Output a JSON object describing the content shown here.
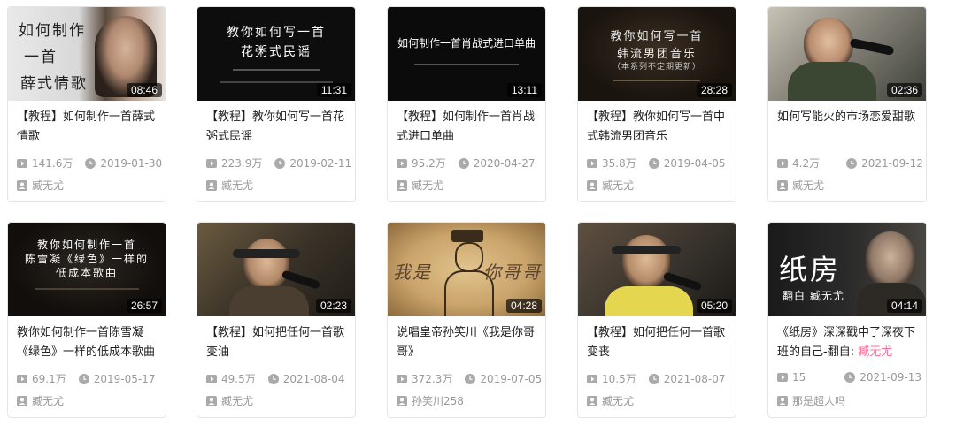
{
  "videos": [
    {
      "title": "【教程】如何制作一首薛式情歌",
      "views": "141.6万",
      "date": "2019-01-30",
      "author": "臧无尤",
      "duration": "08:46",
      "thumb_lines": [
        "如何制作",
        "一首",
        "薛式情歌"
      ]
    },
    {
      "title": "【教程】教你如何写一首花粥式民谣",
      "views": "223.9万",
      "date": "2019-02-11",
      "author": "臧无尤",
      "duration": "11:31",
      "thumb_lines": [
        "教你如何写一首",
        "花粥式民谣"
      ]
    },
    {
      "title": "【教程】如何制作一首肖战式进口单曲",
      "views": "95.2万",
      "date": "2020-04-27",
      "author": "臧无尤",
      "duration": "13:11",
      "thumb_lines": [
        "如何制作一首肖战式进口单曲"
      ]
    },
    {
      "title": "【教程】教你如何写一首中式韩流男团音乐",
      "views": "35.8万",
      "date": "2019-04-05",
      "author": "臧无尤",
      "duration": "28:28",
      "thumb_lines": [
        "教你如何写一首",
        "韩流男团音乐",
        "（本系列不定期更新）"
      ]
    },
    {
      "title": "如何写能火的市场恋爱甜歌",
      "views": "4.2万",
      "date": "2021-09-12",
      "author": "臧无尤",
      "duration": "02:36",
      "thumb_lines": []
    },
    {
      "title": "教你如何制作一首陈雪凝《绿色》一样的低成本歌曲",
      "views": "69.1万",
      "date": "2019-05-17",
      "author": "臧无尤",
      "duration": "26:57",
      "thumb_lines": [
        "教你如何制作一首",
        "陈雪凝《绿色》一样的",
        "低成本歌曲"
      ]
    },
    {
      "title": "【教程】如何把任何一首歌变油",
      "views": "49.5万",
      "date": "2021-08-04",
      "author": "臧无尤",
      "duration": "02:23",
      "thumb_lines": []
    },
    {
      "title": "说唱皇帝孙笑川《我是你哥哥》",
      "views": "372.3万",
      "date": "2019-07-05",
      "author": "孙笑川258",
      "duration": "04:28",
      "thumb_lines": [
        "我是",
        "你哥哥"
      ]
    },
    {
      "title": "【教程】如何把任何一首歌变丧",
      "views": "10.5万",
      "date": "2021-08-07",
      "author": "臧无尤",
      "duration": "05:20",
      "thumb_lines": []
    },
    {
      "title_prefix": "《纸房》深深戳中了深夜下班的自己-翻自: ",
      "title_highlight": "臧无尤",
      "views": "15",
      "date": "2021-09-13",
      "author": "那是超人吗",
      "duration": "04:14",
      "thumb_lines": [
        "纸房",
        "翻白 臧无尤"
      ]
    }
  ],
  "colors": {
    "highlight": "#fb7299",
    "meta": "#999999",
    "title": "#212121"
  },
  "icons": {
    "views": "play-icon",
    "date": "clock-icon",
    "author": "up-icon"
  }
}
